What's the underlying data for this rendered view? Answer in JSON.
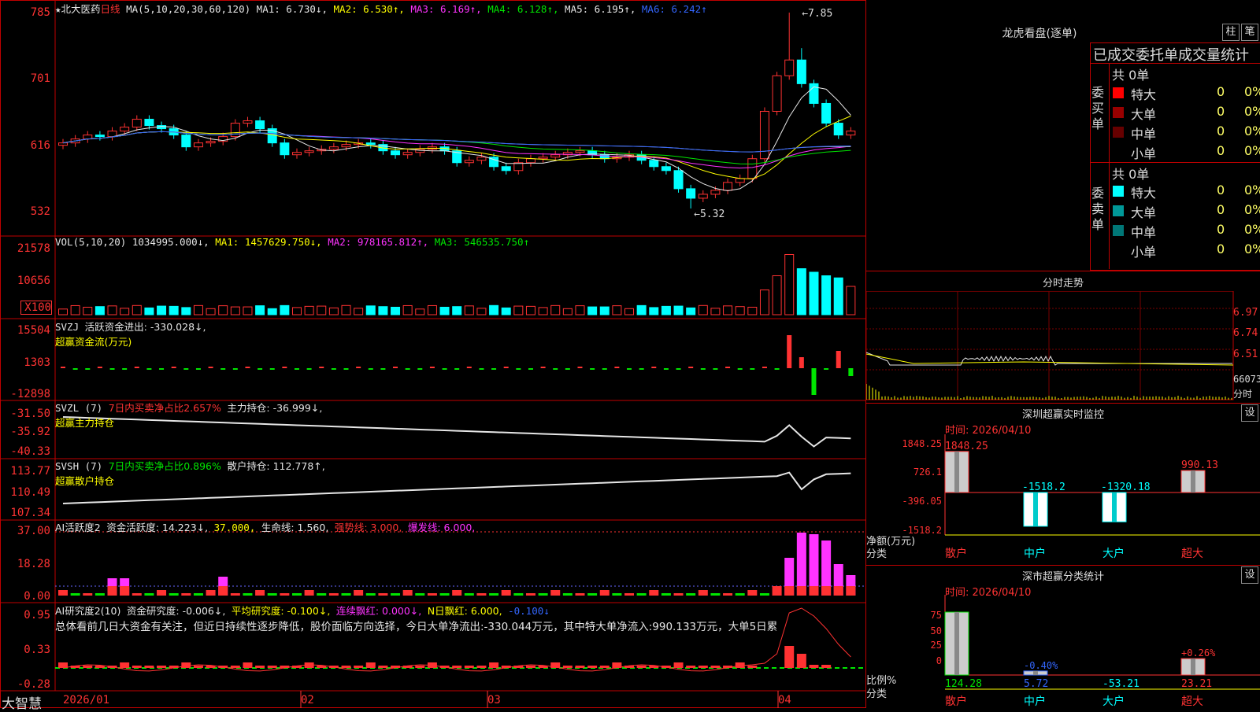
{
  "stock": {
    "star": "★",
    "name": "北大医药",
    "period": "日线"
  },
  "ma_header": {
    "label": "MA(5,10,20,30,60,120)",
    "ma1": "MA1: 6.730↓,",
    "ma2": "MA2: 6.530↑,",
    "ma3": "MA3: 6.169↑,",
    "ma4": "MA4: 6.128↑,",
    "ma5": "MA5: 6.195↑,",
    "ma6": "MA6: 6.242↑"
  },
  "price_axis": [
    "785",
    "701",
    "616",
    "532"
  ],
  "price_annotations": {
    "high": "7.85",
    "low": "5.32"
  },
  "vol_header": {
    "label": "VOL(5,10,20)",
    "value": "1034995.000↓,",
    "ma1": "MA1: 1457629.750↓,",
    "ma2": "MA2: 978165.812↑,",
    "ma3": "MA3: 546535.750↑"
  },
  "vol_axis": [
    "21578",
    "10656",
    "X100"
  ],
  "svzj_header": {
    "label": "SVZJ",
    "text": "活跃资金进出: -330.028↓,",
    "sub": "超赢资金流(万元)"
  },
  "svzj_axis": [
    "15504",
    "1303",
    "-12898"
  ],
  "svzl_header": {
    "label": "SVZL (7)",
    "pct": "7日内买卖净占比2.657%",
    "text": "主力持仓: -36.999↓,",
    "sub": "超赢主力持仓"
  },
  "svzl_axis": [
    "-31.50",
    "-35.92",
    "-40.33"
  ],
  "svsh_header": {
    "label": "SVSH (7)",
    "pct": "7日内买卖净占比0.896%",
    "text": "散户持仓: 112.778↑,",
    "sub": "超赢散户持仓"
  },
  "svsh_axis": [
    "113.77",
    "110.49",
    "107.34"
  ],
  "ai1_header": {
    "label": "AI活跃度2",
    "text": "资金活跃度: 14.223↓,",
    "v37": "37.000,",
    "life": "生命线: 1.560,",
    "strong": "强势线: 3.000,",
    "burst": "爆发线: 6.000,"
  },
  "ai1_axis": [
    "37.00",
    "18.28",
    "0.00"
  ],
  "ai2_header": {
    "label": "AI研究度2(10)",
    "text": "资金研究度: -0.006↓,",
    "avg": "平均研究度: -0.100↓,",
    "lianxu": "连续飘红: 0.000↓,",
    "nday": "N日飘红: 6.000,",
    "neg": "-0.100↓"
  },
  "ai2_comment": "总体看前几日大资金有关注，但近日持续性逐步降低，股价面临方向选择，今日大单净流出:-330.044万元，其中特大单净流入:990.133万元，大单5日累",
  "ai2_axis": [
    "0.95",
    "0.33",
    "-0.28"
  ],
  "date_axis": [
    "2026/01",
    "02",
    "03",
    "04"
  ],
  "brand": "大智慧",
  "right": {
    "title": "龙虎看盘(逐单)",
    "btn1": "柱",
    "btn2": "笔",
    "subtitle": "已成交委托单成交量统计",
    "buy_label": "委买单",
    "sell_label": "委卖单",
    "buy_total": "共 0单",
    "sell_total": "共 0单",
    "rows_buy": [
      {
        "name": "特大",
        "n": "0",
        "p": "0%",
        "color": "#ff0000"
      },
      {
        "name": "大单",
        "n": "0",
        "p": "0%",
        "color": "#990000"
      },
      {
        "name": "中单",
        "n": "0",
        "p": "0%",
        "color": "#660000"
      },
      {
        "name": "小单",
        "n": "0",
        "p": "0%",
        "color": "#000000"
      }
    ],
    "rows_sell": [
      {
        "name": "特大",
        "n": "0",
        "p": "0%",
        "color": "#00ffff"
      },
      {
        "name": "大单",
        "n": "0",
        "p": "0%",
        "color": "#009999"
      },
      {
        "name": "中单",
        "n": "0",
        "p": "0%",
        "color": "#007777"
      },
      {
        "name": "小单",
        "n": "0",
        "p": "0%",
        "color": "#000000"
      }
    ],
    "intraday_title": "分时走势",
    "intraday_axis": [
      "6.97",
      "6.74",
      "6.51",
      "66073",
      "分时"
    ],
    "sz_monitor_title": "深圳超赢实时监控",
    "sz_monitor_btn": "设",
    "sz_time": "时间: 2026/04/10",
    "sz_axis": [
      "1848.25",
      "726.1",
      "-396.05",
      "-1518.2"
    ],
    "sz_net_label": "净额(万元)",
    "sz_cat_label": "分类",
    "sz_bars": [
      {
        "cat": "散户",
        "value": 1848.25,
        "label": "1848.25",
        "cat_color": "#ff3333"
      },
      {
        "cat": "中户",
        "value": -1518.2,
        "label": "-1518.2",
        "cat_color": "#00ffff"
      },
      {
        "cat": "大户",
        "value": -1320.18,
        "label": "-1320.18",
        "cat_color": "#00ffff"
      },
      {
        "cat": "超大",
        "value": 990.13,
        "label": "990.13",
        "cat_color": "#ff3333"
      }
    ],
    "sz_class_title": "深市超赢分类统计",
    "sz_class_btn": "设",
    "sz_class_time": "时间: 2026/04/10",
    "sz_class_axis": [
      "75",
      "50",
      "25",
      "0"
    ],
    "sz_class_ratio_label": "比例%",
    "sz_class_cat_label": "分类",
    "sz_class_bars": [
      {
        "cat": "散户",
        "value": 124.28,
        "pct": "",
        "bottom": "124.28",
        "color": "#00e600"
      },
      {
        "cat": "中户",
        "value": 5.72,
        "pct": "-0.40%",
        "bottom": "5.72",
        "color": "#3366ff"
      },
      {
        "cat": "大户",
        "value": -53.21,
        "pct": "",
        "bottom": "-53.21",
        "color": "#00ffff"
      },
      {
        "cat": "超大",
        "value": 23.21,
        "pct": "+0.26%",
        "bottom": "23.21",
        "color": "#ff3333"
      }
    ]
  },
  "chart_data": {
    "type": "candlestick",
    "title": "北大医药 日线",
    "x": [
      "2026/01",
      "02",
      "03",
      "04"
    ],
    "price_range": [
      5.32,
      7.85
    ],
    "high": 7.85,
    "low": 5.32,
    "ma": {
      "MA1": 6.73,
      "MA2": 6.53,
      "MA3": 6.169,
      "MA4": 6.128,
      "MA5": 6.195,
      "MA6": 6.242
    },
    "closes": [
      6.2,
      6.25,
      6.3,
      6.28,
      6.35,
      6.4,
      6.5,
      6.42,
      6.38,
      6.3,
      6.15,
      6.2,
      6.22,
      6.28,
      6.45,
      6.48,
      6.38,
      6.2,
      6.05,
      6.08,
      6.1,
      6.12,
      6.15,
      6.18,
      6.2,
      6.18,
      6.1,
      6.05,
      6.08,
      6.12,
      6.15,
      6.1,
      5.95,
      5.98,
      6.02,
      5.9,
      5.85,
      5.95,
      6.0,
      6.02,
      6.05,
      6.08,
      6.1,
      6.05,
      6.0,
      6.02,
      6.05,
      5.98,
      5.9,
      5.85,
      5.62,
      5.5,
      5.55,
      5.6,
      5.7,
      5.75,
      6.0,
      6.6,
      7.05,
      7.25,
      6.95,
      6.7,
      6.45,
      6.3,
      6.35
    ],
    "volume_axis": [
      21578,
      10656
    ],
    "svzj_range": [
      -12898,
      15504
    ],
    "svzl_range": [
      -40.33,
      -31.5
    ],
    "svsh_range": [
      107.34,
      113.77
    ],
    "ai1_range": [
      0,
      37
    ],
    "ai2_range": [
      -0.28,
      0.95
    ]
  }
}
